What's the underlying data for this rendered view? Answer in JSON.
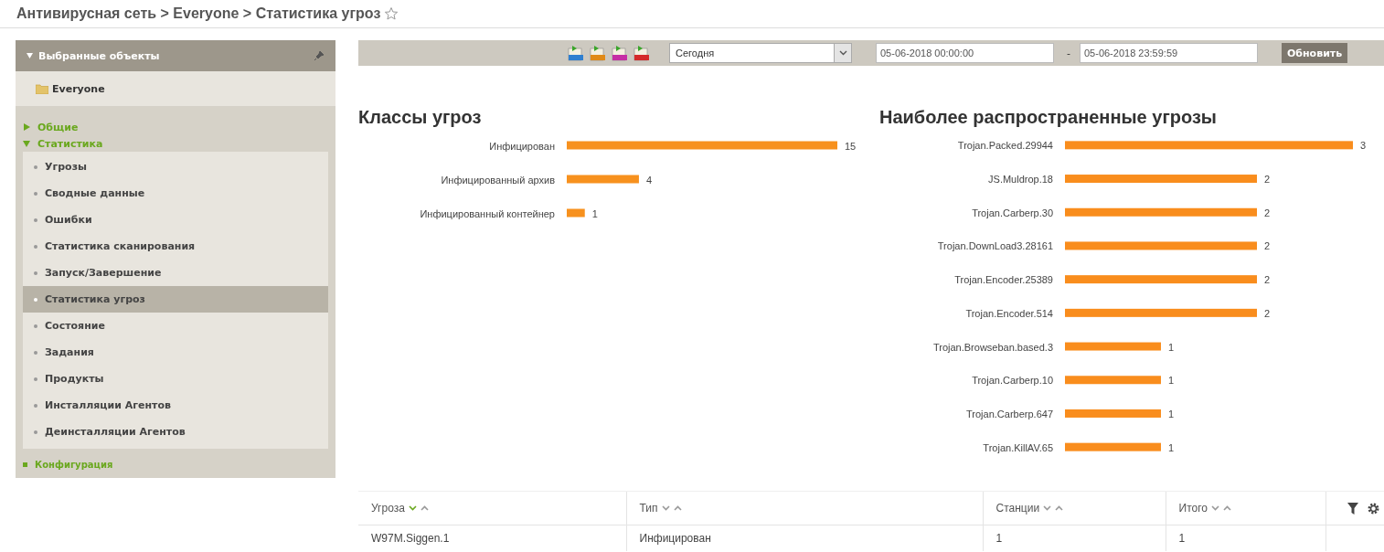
{
  "breadcrumb": "Антивирусная сеть > Everyone > Статистика угроз",
  "sidebar": {
    "title": "Выбранные объекты",
    "group": "Everyone",
    "sections": [
      {
        "label": "Общие",
        "kind": "group",
        "expanded": false
      },
      {
        "label": "Статистика",
        "kind": "group",
        "expanded": true,
        "children": [
          {
            "label": "Угрозы",
            "selected": false
          },
          {
            "label": "Сводные данные",
            "selected": false
          },
          {
            "label": "Ошибки",
            "selected": false
          },
          {
            "label": "Статистика сканирования",
            "selected": false
          },
          {
            "label": "Запуск/Завершение",
            "selected": false
          },
          {
            "label": "Статистика угроз",
            "selected": true
          },
          {
            "label": "Состояние",
            "selected": false
          },
          {
            "label": "Задания",
            "selected": false
          },
          {
            "label": "Продукты",
            "selected": false
          },
          {
            "label": "Инсталляции Агентов",
            "selected": false
          },
          {
            "label": "Деинсталляции Агентов",
            "selected": false
          }
        ]
      },
      {
        "label": "Конфигурация",
        "kind": "link"
      }
    ]
  },
  "toolbar": {
    "period": "Сегодня",
    "date_from": "05-06-2018 00:00:00",
    "separator": "-",
    "date_to": "05-06-2018 23:59:59",
    "refresh_button": "Обновить"
  },
  "charts": [
    {
      "title": "Классы угроз",
      "chart_data": {
        "type": "bar",
        "orientation": "horizontal",
        "data_labels": true,
        "categories": [
          "Инфицирован",
          "Инфицированный архив",
          "Инфицированный контейнер"
        ],
        "series": [
          {
            "color": "#f7911e",
            "values": [
              15,
              4,
              1
            ]
          }
        ]
      }
    },
    {
      "title": "Наиболее распространенные угрозы",
      "chart_data": {
        "type": "bar",
        "orientation": "horizontal",
        "data_labels": true,
        "categories": [
          "Trojan.Packed.29944",
          "JS.Muldrop.18",
          "Trojan.Carberp.30",
          "Trojan.DownLoad3.28161",
          "Trojan.Encoder.25389",
          "Trojan.Encoder.514",
          "Trojan.Browseban.based.3",
          "Trojan.Carberp.10",
          "Trojan.Carberp.647",
          "Trojan.KillAV.65"
        ],
        "series": [
          {
            "color": "#f98d1d",
            "values": [
              3,
              2,
              2,
              2,
              2,
              2,
              1,
              1,
              1,
              1
            ]
          }
        ]
      }
    }
  ],
  "table": {
    "columns": [
      {
        "label": "Угроза",
        "sorted": true
      },
      {
        "label": "Тип",
        "sorted": false
      },
      {
        "label": "Станции",
        "sorted": false
      },
      {
        "label": "Итого",
        "sorted": false
      }
    ],
    "rows": [
      [
        "W97M.Siggen.1",
        "Инфицирован",
        "1",
        "1"
      ]
    ]
  }
}
